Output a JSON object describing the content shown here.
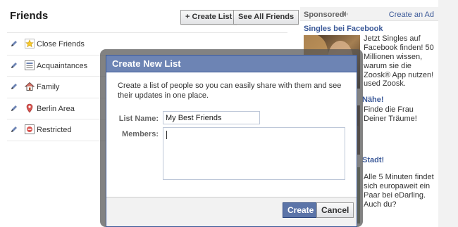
{
  "header": {
    "title": "Friends",
    "create_list_label": "+ Create List",
    "see_all_label": "See All Friends"
  },
  "lists": [
    {
      "label": "Close Friends",
      "icon": "star-icon"
    },
    {
      "label": "Acquaintances",
      "icon": "acquaintances-icon"
    },
    {
      "label": "Family",
      "icon": "house-icon"
    },
    {
      "label": "Berlin Area",
      "icon": "location-pin-icon"
    },
    {
      "label": "Restricted",
      "icon": "restricted-icon"
    }
  ],
  "sidebar": {
    "sponsored_label": "Sponsored",
    "create_ad_label": "Create an Ad",
    "ads": [
      {
        "title": "Singles bei Facebook",
        "text": "Jetzt Singles auf Facebook finden! 50 Millionen wissen, warum sie die Zoosk® App nutzen!",
        "extra": "used Zoosk."
      },
      {
        "title_fragment": "Nähe!",
        "text": "Finde die Frau Deiner Träume!"
      },
      {
        "title_fragment": "Stadt!",
        "text": "Alle 5 Minuten findet sich europaweit ein Paar bei eDarling. Auch du?"
      }
    ]
  },
  "dialog": {
    "title": "Create New List",
    "description": "Create a list of people so you can easily share with them and see their updates in one place.",
    "name_label": "List Name:",
    "name_value": "My Best Friends",
    "members_label": "Members:",
    "members_value": "",
    "create_label": "Create",
    "cancel_label": "Cancel"
  },
  "colors": {
    "brand_blue": "#3b5998",
    "dialog_header": "#6d84b4",
    "primary_button": "#5b74a8"
  }
}
